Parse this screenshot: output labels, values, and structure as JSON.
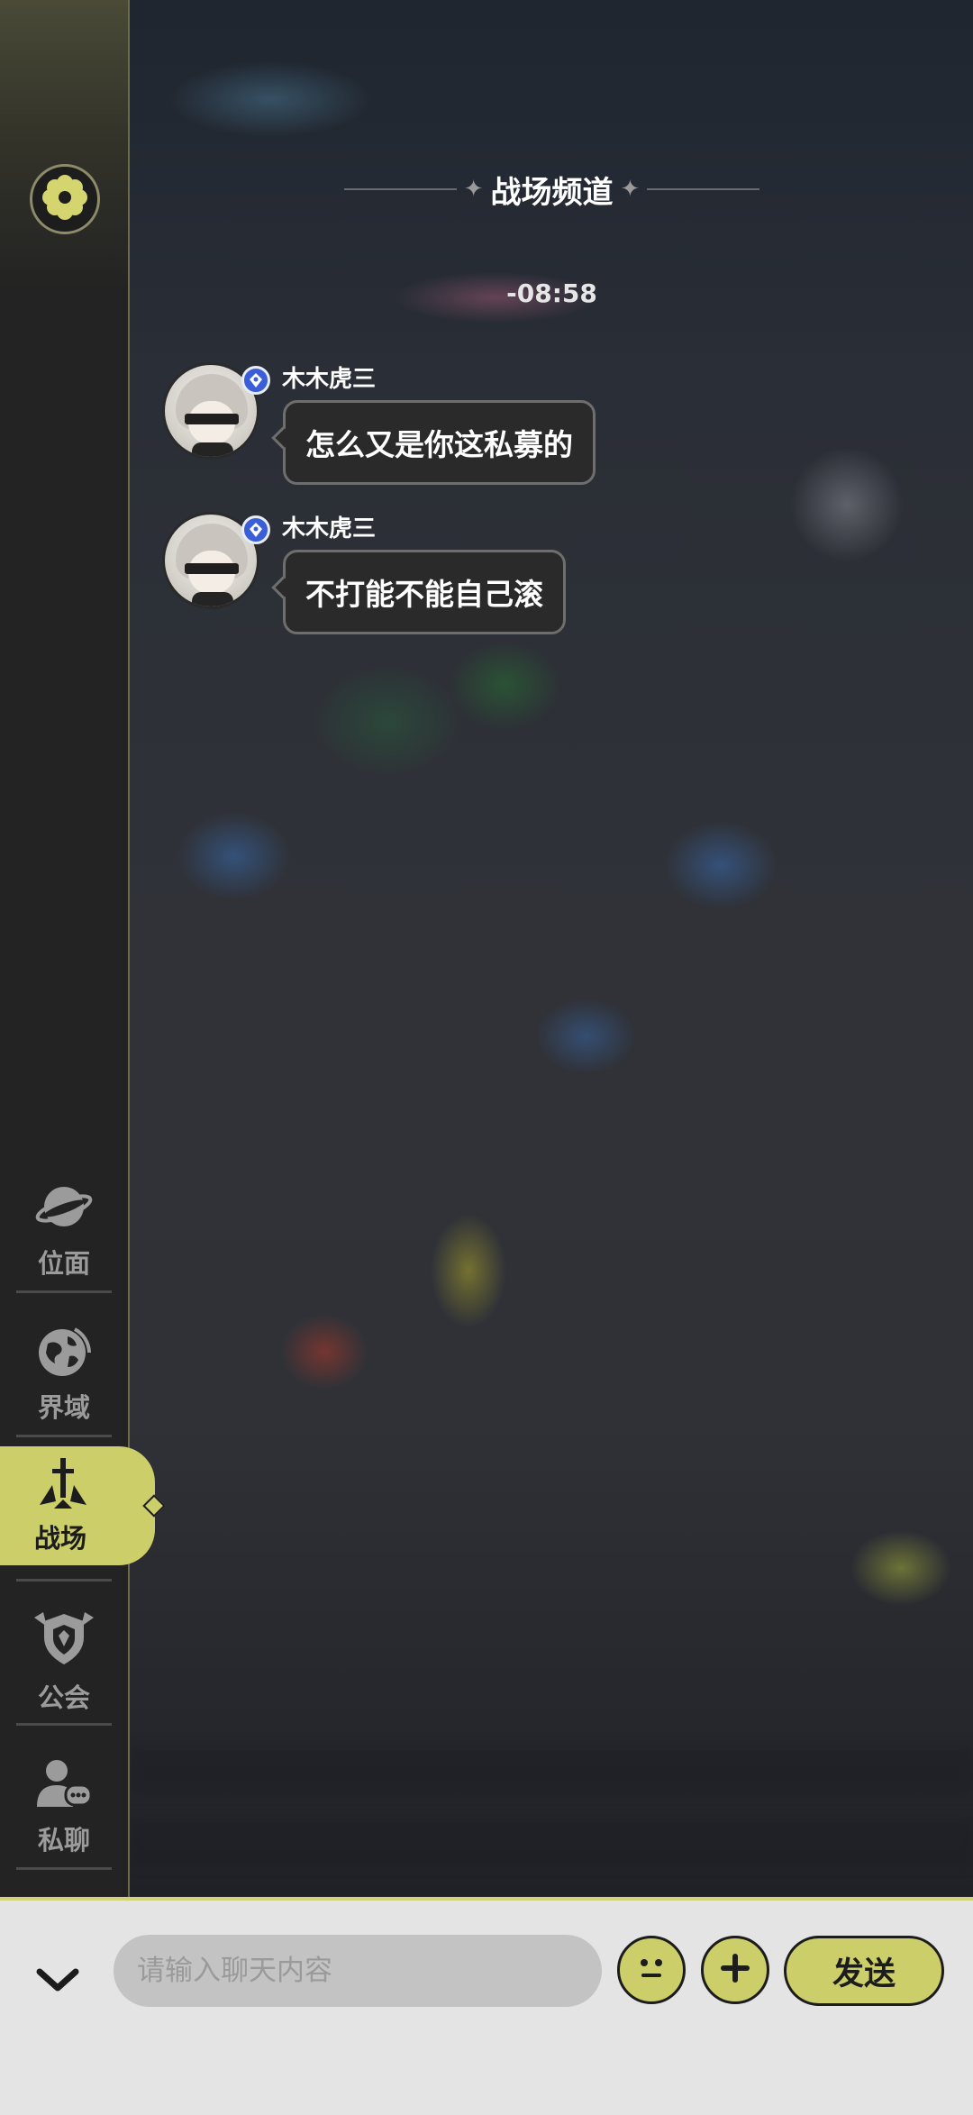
{
  "channel": {
    "title": "战场频道"
  },
  "timestamp": "-08:58",
  "messages": [
    {
      "username": "木木虎三",
      "text": "怎么又是你这私募的"
    },
    {
      "username": "木木虎三",
      "text": "不打能不能自己滚"
    }
  ],
  "sidebar": {
    "settings_icon": "gear-icon",
    "items": [
      {
        "label": "位面",
        "icon": "planet-icon",
        "active": false
      },
      {
        "label": "界域",
        "icon": "globe-icon",
        "active": false
      },
      {
        "label": "战场",
        "icon": "sword-icon",
        "active": true
      },
      {
        "label": "公会",
        "icon": "guild-shield-icon",
        "active": false
      },
      {
        "label": "私聊",
        "icon": "private-chat-icon",
        "active": false
      }
    ]
  },
  "input_bar": {
    "placeholder": "请输入聊天内容",
    "send_label": "发送",
    "collapse_icon": "chevron-down-icon",
    "emoji_icon": "emoji-icon",
    "plus_icon": "plus-icon"
  },
  "colors": {
    "accent": "#ccce6a",
    "sidebar_bg": "#232323",
    "input_bar_bg": "#e4e4e4"
  }
}
